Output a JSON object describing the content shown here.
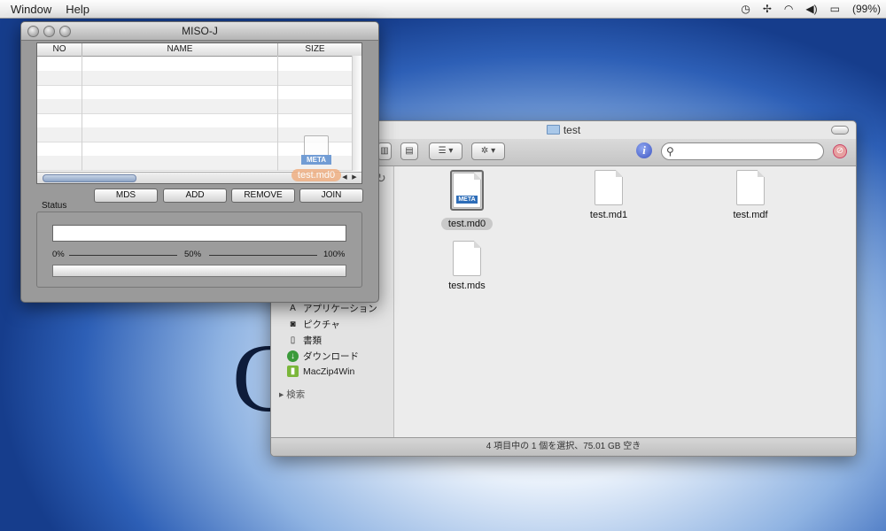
{
  "menubar": {
    "items": [
      "Window",
      "Help"
    ],
    "battery_label": "(99%)"
  },
  "finder": {
    "title": "test",
    "status_text": "4 項目中の 1 個を選択、75.01 GB 空き",
    "sidebar": [
      {
        "label": "アプリケーション",
        "icon": "applications-icon"
      },
      {
        "label": "ピクチャ",
        "icon": "pictures-icon"
      },
      {
        "label": "書類",
        "icon": "documents-icon"
      },
      {
        "label": "ダウンロード",
        "icon": "downloads-icon"
      },
      {
        "label": "MacZip4Win",
        "icon": "maczip-icon"
      }
    ],
    "search_section": "検索",
    "files": [
      {
        "name": "test.md0",
        "selected": true,
        "badge": "META"
      },
      {
        "name": "test.md1",
        "selected": false
      },
      {
        "name": "test.mdf",
        "selected": false
      },
      {
        "name": "test.mds",
        "selected": false
      }
    ]
  },
  "miso": {
    "title": "MISO-J",
    "columns": [
      "NO",
      "NAME",
      "SIZE"
    ],
    "drag_file": {
      "name": "test.md0",
      "badge": "META"
    },
    "buttons": [
      "MDS",
      "ADD",
      "REMOVE",
      "JOIN"
    ],
    "status_label": "Status",
    "scale": [
      "0%",
      "50%",
      "100%"
    ],
    "progress": 0
  },
  "colors": {
    "selection_accent": "#2d6db8",
    "drag_label": "#f0b083"
  }
}
